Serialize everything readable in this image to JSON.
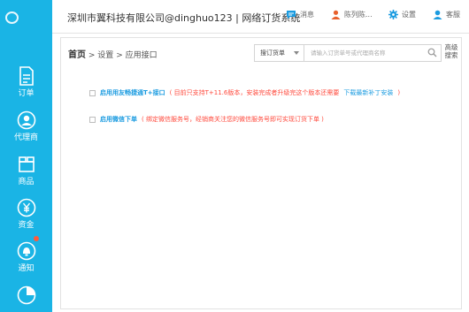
{
  "header": {
    "company": "深圳市翼科技有限公司@dinghuo123 | 网络订货系统",
    "messages": "消息",
    "user": "陈列陈...",
    "settings": "设置",
    "help": "客服"
  },
  "sidebar": {
    "items": [
      {
        "label": "订单",
        "icon": "document-icon"
      },
      {
        "label": "代理商",
        "icon": "user-icon"
      },
      {
        "label": "商品",
        "icon": "box-icon"
      },
      {
        "label": "资金",
        "icon": "yuan-icon"
      },
      {
        "label": "通知",
        "icon": "bell-icon"
      },
      {
        "label": "",
        "icon": "pie-chart-icon"
      }
    ],
    "notice_dot_color": "#ff5a3c"
  },
  "main": {
    "breadcrumb": {
      "home": "首页",
      "sep1": ">",
      "settings": "设置",
      "sep2": ">",
      "current": "应用接口"
    },
    "search": {
      "select": "搜订货单",
      "placeholder": "请输入订货单号或代理商名称"
    },
    "advanced_search": "高级搜索",
    "options": [
      {
        "label": "启用用友畅捷通T+接口",
        "note": "( 目前只支持T+11.6版本，安装完成者升级完这个版本还需要",
        "link": "下载最新补丁安装",
        "note_end": ")"
      },
      {
        "label": "启用微信下单",
        "note": "( 绑定微信服务号，经销商关注您的微信服务号即可实现订货下单 )"
      }
    ]
  },
  "colors": {
    "sidebar": "#1ab4e5",
    "accent": "#1a9be0",
    "note": "#ff4a3d"
  }
}
